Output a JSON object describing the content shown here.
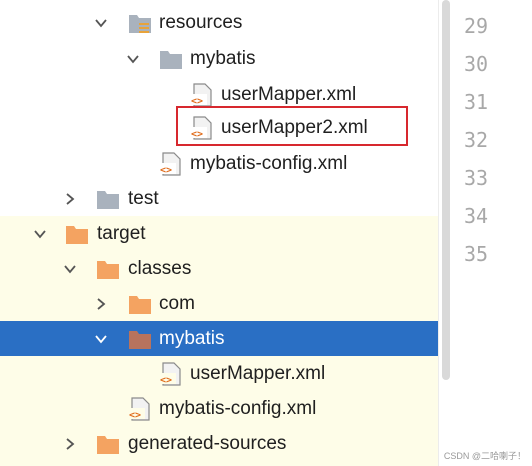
{
  "tree": {
    "items": [
      {
        "label": "resources",
        "icon": "resources-folder-icon",
        "expanded": true
      },
      {
        "label": "mybatis",
        "icon": "folder-icon",
        "expanded": true
      },
      {
        "label": "userMapper.xml",
        "icon": "xml-file-icon"
      },
      {
        "label": "userMapper2.xml",
        "icon": "xml-file-icon",
        "highlighted": true
      },
      {
        "label": "mybatis-config.xml",
        "icon": "xml-file-icon"
      },
      {
        "label": "test",
        "icon": "folder-icon",
        "expanded": false
      },
      {
        "label": "target",
        "icon": "excluded-folder-icon",
        "expanded": true
      },
      {
        "label": "classes",
        "icon": "excluded-folder-icon",
        "expanded": true
      },
      {
        "label": "com",
        "icon": "excluded-folder-icon",
        "expanded": false
      },
      {
        "label": "mybatis",
        "icon": "excluded-folder-icon",
        "expanded": true,
        "selected": true
      },
      {
        "label": "userMapper.xml",
        "icon": "xml-file-icon"
      },
      {
        "label": "mybatis-config.xml",
        "icon": "xml-file-icon"
      },
      {
        "label": "generated-sources",
        "icon": "excluded-folder-icon",
        "expanded": false
      }
    ]
  },
  "editor": {
    "line_numbers": [
      "29",
      "30",
      "31",
      "32",
      "33",
      "34",
      "35"
    ]
  },
  "watermark": "CSDN @二哈喇子！",
  "colors": {
    "selection": "#2a6fc4",
    "highlight_border": "#d7282e",
    "excluded_background": "#fefde8",
    "folder_gray": "#a9b2bd",
    "folder_orange": "#f4a361",
    "folder_selected": "#b8735d",
    "xml_tag": "#e06c1b"
  }
}
